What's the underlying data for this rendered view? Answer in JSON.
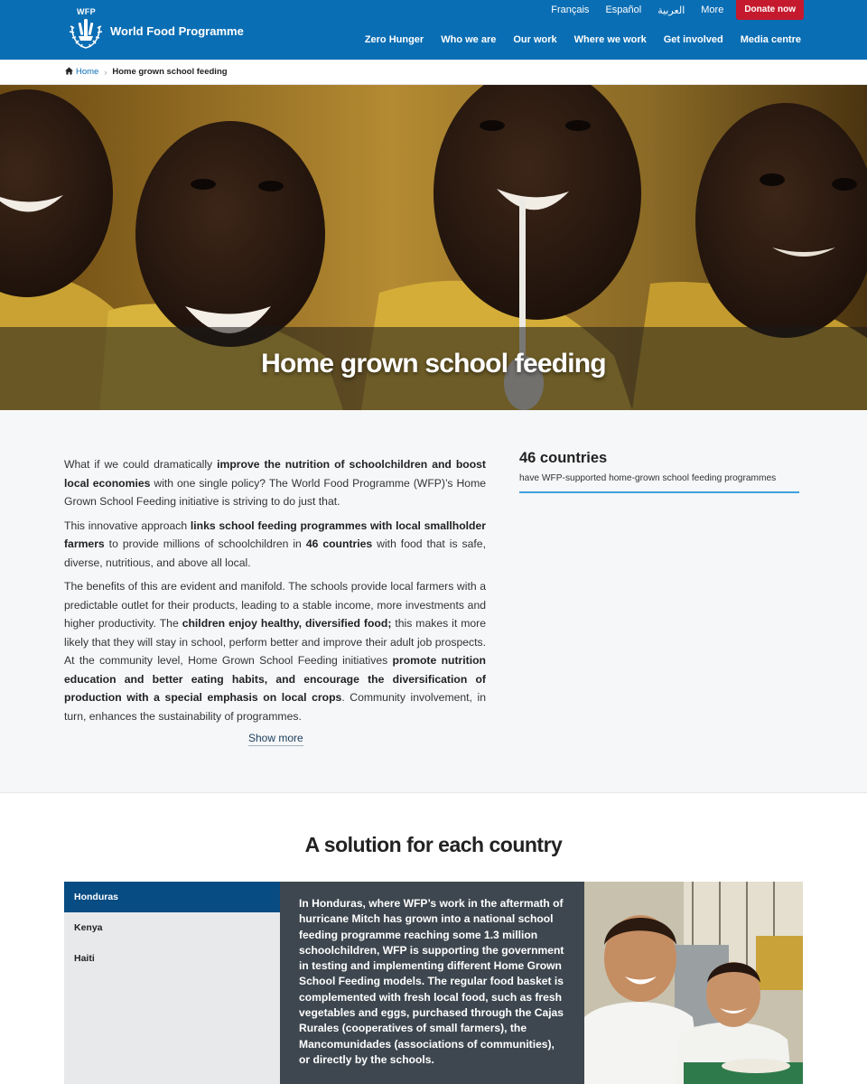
{
  "header": {
    "logo_abbr": "WFP",
    "logo_name": "World Food Programme",
    "top_links": [
      "Français",
      "Español",
      "العربية",
      "More"
    ],
    "donate_label": "Donate now",
    "nav": [
      "Zero Hunger",
      "Who we are",
      "Our work",
      "Where we work",
      "Get involved",
      "Media centre"
    ],
    "colors": {
      "brand_blue": "#0a6eb4",
      "donate_red": "#c5192d"
    }
  },
  "breadcrumb": {
    "home": "Home",
    "current": "Home grown school feeding"
  },
  "hero": {
    "title": "Home grown school feeding"
  },
  "intro": {
    "p1": {
      "a": "What if we could dramatically ",
      "b": "improve the nutrition of schoolchildren and boost local economies",
      "c": " with one single policy? The World Food Programme (WFP)’s Home Grown School Feeding initiative is striving to do just that."
    },
    "p2": {
      "a": "This innovative approach ",
      "b": "links school feeding programmes with local smallholder farmers",
      "c": " to provide millions of schoolchildren in ",
      "d": "46 countries",
      "e": " with food that is safe, diverse, nutritious, and above all local."
    },
    "p3": {
      "a": "The benefits of this are evident and manifold. The schools provide local farmers with a predictable outlet for their products, leading to a stable income, more investments and higher productivity. The ",
      "b": "children enjoy healthy, diversified food;",
      "c": " this makes it more likely that they will stay in school, perform better and improve their adult job prospects. At the community level, Home Grown School Feeding initiatives ",
      "d": "promote nutrition education and better eating habits, and encourage the diversification of production with a special emphasis on local crops",
      "e": ". Community involvement, in turn, enhances the sustainability of programmes."
    },
    "show_more": "Show more"
  },
  "stat": {
    "value": "46 countries",
    "description": "have WFP-supported home-grown school feeding programmes"
  },
  "solution": {
    "title": "A solution for each country",
    "tabs": [
      "Honduras",
      "Kenya",
      "Haiti"
    ],
    "active_tab": "Honduras",
    "panel_text": "In Honduras, where WFP’s work in the aftermath of hurricane Mitch has grown into a national school feeding programme reaching some 1.3 million schoolchildren, WFP is supporting the government in testing and implementing different Home Grown School Feeding models. The regular food basket is complemented with fresh local food, such as fresh vegetables and eggs, purchased through the Cajas Rurales (cooperatives of small farmers), the Mancomunidades (associations of communities), or directly by the schools."
  }
}
